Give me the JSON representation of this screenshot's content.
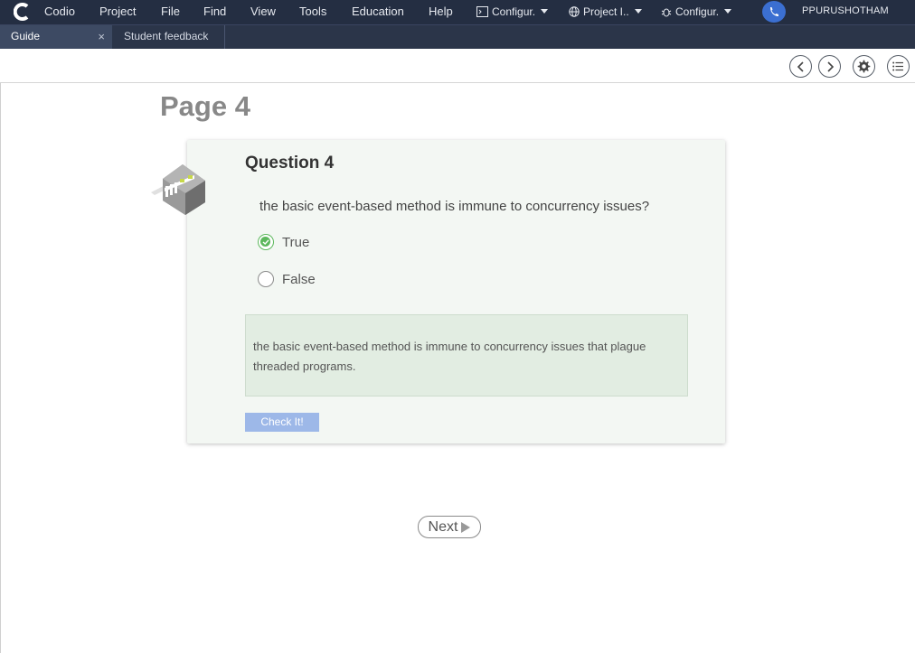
{
  "menubar": {
    "items": [
      "Codio",
      "Project",
      "File",
      "Find",
      "View",
      "Tools",
      "Education",
      "Help"
    ],
    "dropdowns": [
      {
        "label": "Configur.",
        "icon": "terminal-icon"
      },
      {
        "label": "Project I..",
        "icon": "globe-icon"
      },
      {
        "label": "Configur.",
        "icon": "bug-icon"
      }
    ],
    "user": "PPURUSHOTHAM"
  },
  "tabs": [
    {
      "label": "Guide",
      "active": true,
      "close": "×"
    },
    {
      "label": "Student feedback",
      "active": false
    }
  ],
  "page": {
    "title": "Page 4",
    "question": {
      "title": "Question 4",
      "text": "the basic event-based method is immune to concurrency issues?",
      "options": [
        {
          "label": "True",
          "selected": true
        },
        {
          "label": "False",
          "selected": false
        }
      ],
      "feedback": "the basic event-based method is immune to concurrency issues that plague threaded programs.",
      "check_label": "Check It!"
    },
    "next_label": "Next"
  },
  "colors": {
    "menubar": "#242e42",
    "card": "#f3f7f3",
    "feedback": "#e2ede2",
    "check_button": "#9db8e8",
    "selected_radio": "#5cb85c"
  }
}
